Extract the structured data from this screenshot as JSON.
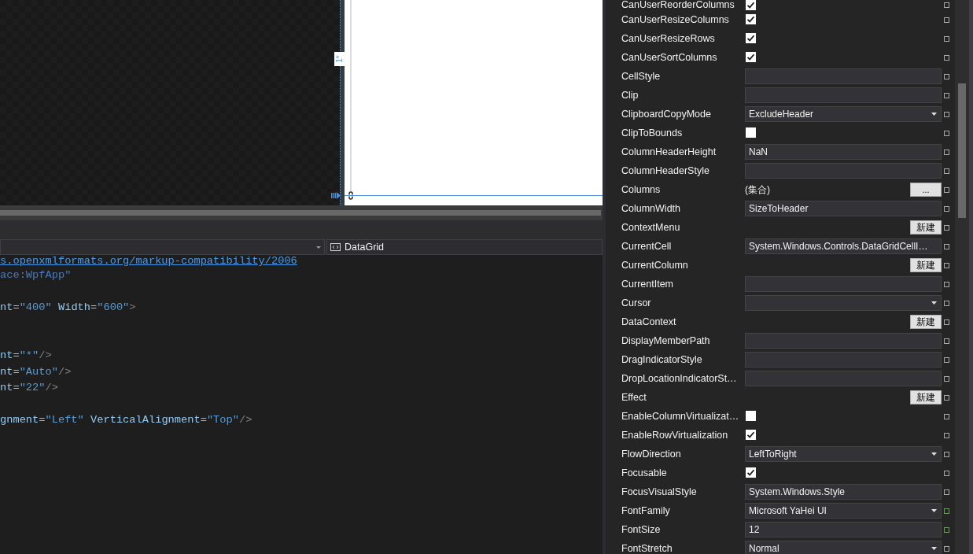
{
  "designer": {
    "row_size_label": "1*"
  },
  "navigation_bar": {
    "element_dropdown": "DataGrid"
  },
  "code_lines": [
    {
      "kind": "code",
      "tokens": [
        {
          "kind": "link",
          "text": "s.openxmlformats.org/markup-compatibility/2006"
        }
      ]
    },
    {
      "kind": "code",
      "tokens": [
        {
          "kind": "namespace",
          "text": "ace:WpfApp\""
        }
      ]
    },
    {
      "kind": "blank"
    },
    {
      "kind": "code",
      "tokens": [
        {
          "kind": "attribute",
          "text": "nt"
        },
        {
          "kind": "equals",
          "text": "="
        },
        {
          "kind": "value",
          "text": "\"400\""
        },
        {
          "kind": "attribute",
          "text": " Width"
        },
        {
          "kind": "equals",
          "text": "="
        },
        {
          "kind": "value",
          "text": "\"600\""
        },
        {
          "kind": "punctuation",
          "text": ">"
        }
      ]
    },
    {
      "kind": "blank"
    },
    {
      "kind": "blank"
    },
    {
      "kind": "code",
      "tokens": [
        {
          "kind": "attribute",
          "text": "nt"
        },
        {
          "kind": "equals",
          "text": "="
        },
        {
          "kind": "value",
          "text": "\"*\""
        },
        {
          "kind": "punctuation",
          "text": "/>"
        }
      ]
    },
    {
      "kind": "code",
      "tokens": [
        {
          "kind": "attribute",
          "text": "nt"
        },
        {
          "kind": "equals",
          "text": "="
        },
        {
          "kind": "value",
          "text": "\"Auto\""
        },
        {
          "kind": "punctuation",
          "text": "/>"
        }
      ]
    },
    {
      "kind": "code",
      "tokens": [
        {
          "kind": "attribute",
          "text": "nt"
        },
        {
          "kind": "equals",
          "text": "="
        },
        {
          "kind": "value",
          "text": "\"22\""
        },
        {
          "kind": "punctuation",
          "text": "/>"
        }
      ]
    },
    {
      "kind": "blank"
    },
    {
      "kind": "code",
      "tokens": [
        {
          "kind": "attribute",
          "text": "gnment"
        },
        {
          "kind": "equals",
          "text": "="
        },
        {
          "kind": "value",
          "text": "\"Left\""
        },
        {
          "kind": "attribute",
          "text": " VerticalAlignment"
        },
        {
          "kind": "equals",
          "text": "="
        },
        {
          "kind": "value",
          "text": "\"Top\""
        },
        {
          "kind": "punctuation",
          "text": "/>"
        }
      ]
    }
  ],
  "properties": [
    {
      "name": "CanUserReorderColumns",
      "kind": "checkbox",
      "checked": true,
      "inherited": false
    },
    {
      "name": "CanUserResizeColumns",
      "kind": "checkbox",
      "checked": true,
      "inherited": false
    },
    {
      "name": "CanUserResizeRows",
      "kind": "checkbox",
      "checked": true,
      "inherited": false
    },
    {
      "name": "CanUserSortColumns",
      "kind": "checkbox",
      "checked": true,
      "inherited": false
    },
    {
      "name": "CellStyle",
      "kind": "text",
      "inherited": false
    },
    {
      "name": "Clip",
      "kind": "text",
      "inherited": false
    },
    {
      "name": "ClipboardCopyMode",
      "kind": "dropdown",
      "value": "ExcludeHeader",
      "inherited": false
    },
    {
      "name": "ClipToBounds",
      "kind": "checkbox",
      "checked": false,
      "inherited": false
    },
    {
      "name": "ColumnHeaderHeight",
      "kind": "text",
      "value": "NaN",
      "inherited": false
    },
    {
      "name": "ColumnHeaderStyle",
      "kind": "text",
      "inherited": false
    },
    {
      "name": "Columns",
      "kind": "collection",
      "value": "(集合)",
      "button": "...",
      "inherited": false
    },
    {
      "name": "ColumnWidth",
      "kind": "text",
      "value": "SizeToHeader",
      "inherited": false
    },
    {
      "name": "ContextMenu",
      "kind": "button",
      "button": "新建",
      "inherited": false
    },
    {
      "name": "CurrentCell",
      "kind": "text",
      "value": "System.Windows.Controls.DataGridCellI…",
      "inherited": false
    },
    {
      "name": "CurrentColumn",
      "kind": "button",
      "button": "新建",
      "inherited": false
    },
    {
      "name": "CurrentItem",
      "kind": "text",
      "inherited": false
    },
    {
      "name": "Cursor",
      "kind": "dropdown",
      "inherited": false
    },
    {
      "name": "DataContext",
      "kind": "button",
      "button": "新建",
      "inherited": false
    },
    {
      "name": "DisplayMemberPath",
      "kind": "text",
      "inherited": false
    },
    {
      "name": "DragIndicatorStyle",
      "kind": "text",
      "inherited": false
    },
    {
      "name": "DropLocationIndicatorSt…",
      "kind": "text",
      "inherited": false
    },
    {
      "name": "Effect",
      "kind": "button",
      "button": "新建",
      "inherited": false
    },
    {
      "name": "EnableColumnVirtualizat…",
      "kind": "checkbox",
      "checked": false,
      "inherited": false
    },
    {
      "name": "EnableRowVirtualization",
      "kind": "checkbox",
      "checked": true,
      "inherited": false
    },
    {
      "name": "FlowDirection",
      "kind": "dropdown",
      "value": "LeftToRight",
      "inherited": false
    },
    {
      "name": "Focusable",
      "kind": "checkbox",
      "checked": true,
      "inherited": false
    },
    {
      "name": "FocusVisualStyle",
      "kind": "text",
      "value": "System.Windows.Style",
      "inherited": false
    },
    {
      "name": "FontFamily",
      "kind": "dropdown",
      "value": "Microsoft YaHei UI",
      "inherited": true
    },
    {
      "name": "FontSize",
      "kind": "text",
      "value": "12",
      "inherited": true
    },
    {
      "name": "FontStretch",
      "kind": "dropdown",
      "value": "Normal",
      "inherited": false
    }
  ]
}
